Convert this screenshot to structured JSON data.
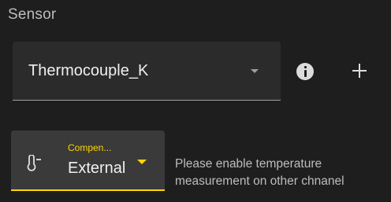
{
  "sensor_section": {
    "label": "Sensor"
  },
  "sensor_select": {
    "value": "Thermocouple_K",
    "caret_icon": "arrow-drop-down-icon"
  },
  "actions": {
    "info_icon": "info-icon",
    "add_icon": "plus-icon"
  },
  "compensation_select": {
    "icon": "thermometer-minus-icon",
    "label": "Compen...",
    "value": "External",
    "caret_icon": "arrow-drop-down-icon",
    "accent_color": "#ffd600"
  },
  "hint": {
    "text": "Please enable temperature\nmeasurement on other chnanel"
  }
}
